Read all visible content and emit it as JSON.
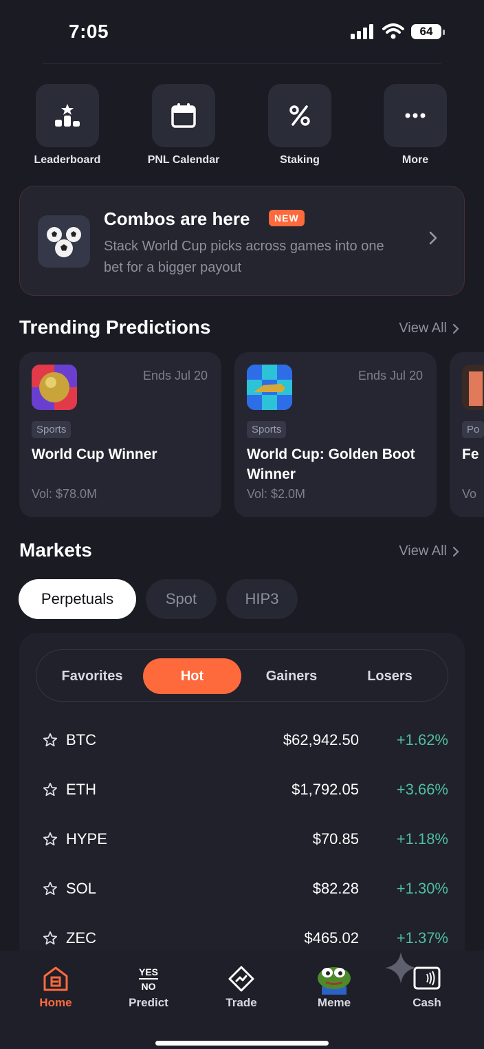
{
  "status": {
    "time": "7:05",
    "battery": "64"
  },
  "quick_actions": [
    {
      "label": "Leaderboard",
      "icon": "leaderboard-icon"
    },
    {
      "label": "PNL Calendar",
      "icon": "calendar-icon"
    },
    {
      "label": "Staking",
      "icon": "percent-icon"
    },
    {
      "label": "More",
      "icon": "more-icon"
    }
  ],
  "banner": {
    "title": "Combos are here",
    "badge": "NEW",
    "subtitle": "Stack World Cup picks across games into one bet for a bigger payout",
    "icon": "soccer-balls-icon"
  },
  "trending": {
    "title": "Trending Predictions",
    "view_all": "View All",
    "cards": [
      {
        "ends": "Ends Jul 20",
        "tag": "Sports",
        "title": "World Cup Winner",
        "vol": "Vol: $78.0M"
      },
      {
        "ends": "Ends Jul 20",
        "tag": "Sports",
        "title": "World Cup: Golden Boot Winner",
        "vol": "Vol: $2.0M"
      },
      {
        "ends": "",
        "tag": "Po",
        "title": "Fe",
        "vol": "Vo"
      }
    ]
  },
  "markets": {
    "title": "Markets",
    "view_all": "View All",
    "tabs": [
      "Perpetuals",
      "Spot",
      "HIP3"
    ],
    "active_tab": "Perpetuals",
    "filters": [
      "Favorites",
      "Hot",
      "Gainers",
      "Losers"
    ],
    "active_filter": "Hot",
    "rows": [
      {
        "symbol": "BTC",
        "price": "$62,942.50",
        "change": "+1.62%"
      },
      {
        "symbol": "ETH",
        "price": "$1,792.05",
        "change": "+3.66%"
      },
      {
        "symbol": "HYPE",
        "price": "$70.85",
        "change": "+1.18%"
      },
      {
        "symbol": "SOL",
        "price": "$82.28",
        "change": "+1.30%"
      },
      {
        "symbol": "ZEC",
        "price": "$465.02",
        "change": "+1.37%"
      }
    ]
  },
  "nav": {
    "items": [
      {
        "label": "Home",
        "icon": "home-icon"
      },
      {
        "label": "Predict",
        "icon": "yes-no-icon",
        "icon_text_top": "YES",
        "icon_text_bottom": "NO"
      },
      {
        "label": "Trade",
        "icon": "trade-icon"
      },
      {
        "label": "Meme",
        "icon": "frog-icon"
      },
      {
        "label": "Cash",
        "icon": "cash-icon"
      }
    ],
    "active": "Home"
  },
  "colors": {
    "accent": "#ff6a3d",
    "positive": "#4fbf9f",
    "background": "#1a1b23"
  }
}
